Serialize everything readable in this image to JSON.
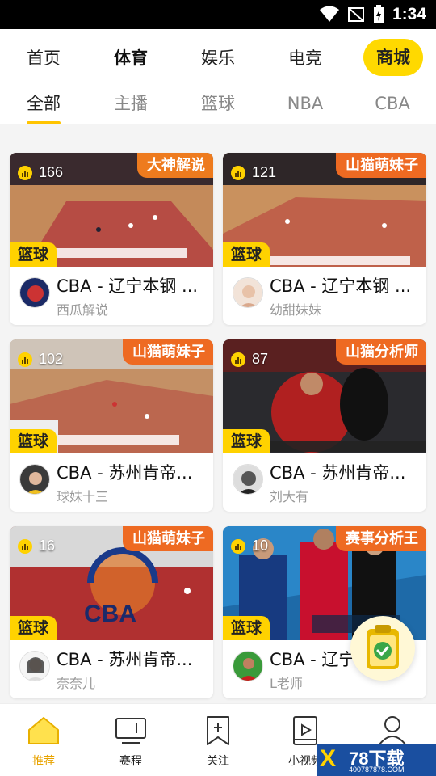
{
  "status_bar": {
    "time": "1:34"
  },
  "categories": [
    {
      "label": "首页"
    },
    {
      "label": "体育"
    },
    {
      "label": "娱乐"
    },
    {
      "label": "电竞"
    },
    {
      "label": "商城"
    }
  ],
  "active_category": "体育",
  "subtabs": [
    {
      "label": "全部"
    },
    {
      "label": "主播"
    },
    {
      "label": "篮球"
    },
    {
      "label": "NBA"
    },
    {
      "label": "CBA"
    }
  ],
  "active_subtab": "全部",
  "cards": [
    {
      "viewers": "166",
      "tag": "大神解说",
      "tag_color": "#ee7b1e",
      "sport": "篮球",
      "title": "CBA - 辽宁本钢 ...",
      "author": "西瓜解说"
    },
    {
      "viewers": "121",
      "tag": "山猫萌妹子",
      "tag_color": "#ee6a22",
      "sport": "篮球",
      "title": "CBA - 辽宁本钢 ...",
      "author": "幼甜妹妹"
    },
    {
      "viewers": "102",
      "tag": "山猫萌妹子",
      "tag_color": "#ee6a22",
      "sport": "篮球",
      "title": "CBA - 苏州肯帝...",
      "author": "球妹十三"
    },
    {
      "viewers": "87",
      "tag": "山猫分析师",
      "tag_color": "#ee6a22",
      "sport": "篮球",
      "title": "CBA - 苏州肯帝...",
      "author": "刘大有"
    },
    {
      "viewers": "16",
      "tag": "山猫萌妹子",
      "tag_color": "#ee6a22",
      "sport": "篮球",
      "title": "CBA - 苏州肯帝...",
      "author": "奈奈儿"
    },
    {
      "viewers": "10",
      "tag": "赛事分析王",
      "tag_color": "#ee6a22",
      "sport": "篮球",
      "title": "CBA - 辽宁",
      "author": "L老师"
    }
  ],
  "bottom_nav": [
    {
      "label": "推荐",
      "icon": "home-icon"
    },
    {
      "label": "赛程",
      "icon": "schedule-icon"
    },
    {
      "label": "关注",
      "icon": "bookmark-icon"
    },
    {
      "label": "小视频",
      "icon": "video-icon"
    },
    {
      "label": "",
      "icon": "profile-icon"
    }
  ],
  "active_nav": "推荐",
  "watermark": {
    "brand": "78下载",
    "url": "400787878.COM"
  },
  "colors": {
    "accent": "#ffd200",
    "active_underline": "#ffc400",
    "tag": "#ee6a22"
  }
}
